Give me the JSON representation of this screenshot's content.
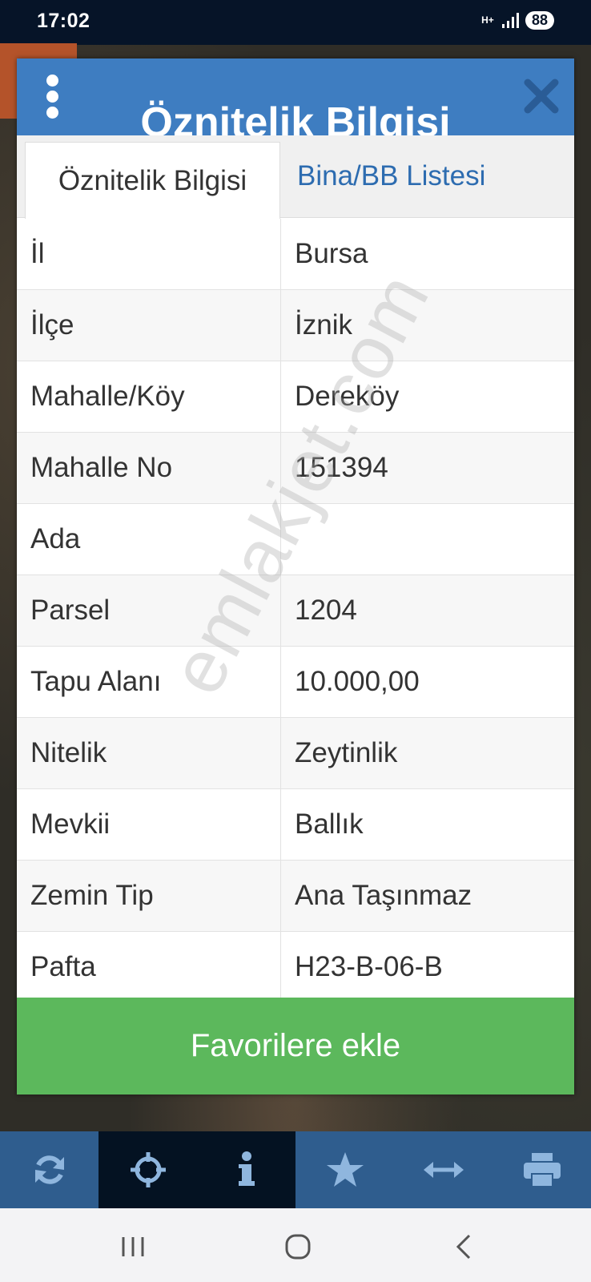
{
  "status_bar": {
    "time": "17:02",
    "network": "H+",
    "battery": "88"
  },
  "modal": {
    "title": "Öznitelik Bilgisi",
    "tabs": [
      {
        "label": "Öznitelik Bilgisi",
        "active": true
      },
      {
        "label": "Bina/BB Listesi",
        "active": false
      }
    ],
    "rows": [
      {
        "key": "İl",
        "value": "Bursa"
      },
      {
        "key": "İlçe",
        "value": "İznik"
      },
      {
        "key": "Mahalle/Köy",
        "value": "Dereköy"
      },
      {
        "key": "Mahalle No",
        "value": "151394"
      },
      {
        "key": "Ada",
        "value": ""
      },
      {
        "key": "Parsel",
        "value": "1204"
      },
      {
        "key": "Tapu Alanı",
        "value": "10.000,00"
      },
      {
        "key": "Nitelik",
        "value": "Zeytinlik"
      },
      {
        "key": "Mevkii",
        "value": "Ballık"
      },
      {
        "key": "Zemin Tip",
        "value": "Ana Taşınmaz"
      },
      {
        "key": "Pafta",
        "value": "H23-B-06-B"
      }
    ],
    "favorite_label": "Favorilere ekle"
  },
  "watermark": "emlakjet.com",
  "toolbar": {
    "items": [
      {
        "icon": "refresh-icon"
      },
      {
        "icon": "crosshair-icon"
      },
      {
        "icon": "info-icon"
      },
      {
        "icon": "star-icon"
      },
      {
        "icon": "measure-icon"
      },
      {
        "icon": "print-icon"
      }
    ]
  },
  "colors": {
    "header": "#3e7dc1",
    "favorite": "#5cb85c",
    "toolbar": "#2f5d8e",
    "toolbar_active": "#041222",
    "tab_link": "#2d6cb0"
  }
}
